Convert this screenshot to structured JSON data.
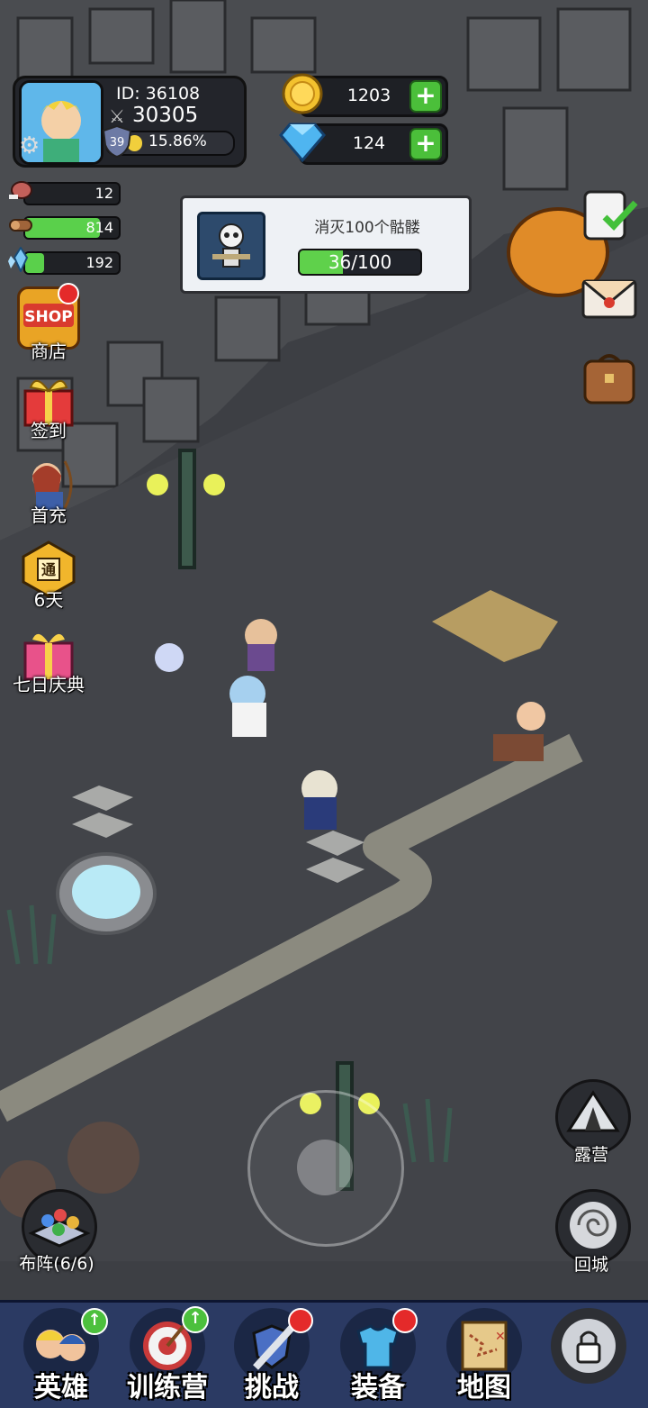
{
  "player": {
    "id_text": "ID: 36108",
    "power": "30305",
    "level": "39",
    "exp_percent": "15.86%",
    "exp_fraction": 0.1586
  },
  "currency": {
    "gold": "1203",
    "gems": "124"
  },
  "resources": [
    {
      "name": "meat-icon",
      "value": "12",
      "fill": 0.0
    },
    {
      "name": "wood-icon",
      "value": "814",
      "fill": 0.8
    },
    {
      "name": "crystal-icon",
      "value": "192",
      "fill": 0.2
    }
  ],
  "quest": {
    "title": "消灭100个骷髅",
    "progress_text": "36/100",
    "progress": 0.36
  },
  "left_menu": [
    {
      "label": "商店",
      "icon": "shop-icon",
      "badge": true
    },
    {
      "label": "签到",
      "icon": "gift-box-icon",
      "badge": false
    },
    {
      "label": "首充",
      "icon": "archer-hero-icon",
      "badge": false
    },
    {
      "label": "6天",
      "icon": "pass-icon",
      "badge": false
    },
    {
      "label": "七日庆典",
      "icon": "celebration-gift-icon",
      "badge": false
    }
  ],
  "right_side": {
    "camp_label": "露营",
    "return_label": "回城"
  },
  "formation_label": "布阵(6/6)",
  "bottom_nav": [
    {
      "label": "英雄",
      "icon": "heroes-icon",
      "badge": "up"
    },
    {
      "label": "训练营",
      "icon": "training-target-icon",
      "badge": "up"
    },
    {
      "label": "挑战",
      "icon": "sword-shield-icon",
      "badge": "dot"
    },
    {
      "label": "装备",
      "icon": "armor-icon",
      "badge": "dot"
    },
    {
      "label": "地图",
      "icon": "map-scroll-icon",
      "badge": ""
    },
    {
      "label": "",
      "icon": "locked-icon",
      "badge": ""
    }
  ],
  "colors": {
    "accent_green": "#4bbf3a",
    "badge_red": "#e42a2a",
    "nav_bg": "#2b3a63"
  }
}
